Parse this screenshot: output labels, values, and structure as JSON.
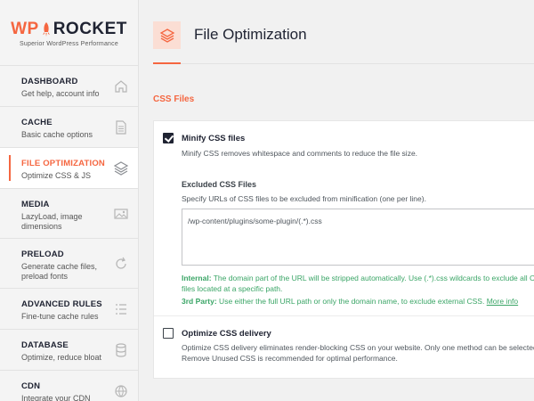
{
  "brand": {
    "wp": "WP",
    "rocket": "ROCKET",
    "tagline": "Superior WordPress Performance",
    "accent_color": "#f56640"
  },
  "nav": {
    "items": [
      {
        "title": "DASHBOARD",
        "subtitle": "Get help, account info",
        "icon": "home-icon"
      },
      {
        "title": "CACHE",
        "subtitle": "Basic cache options",
        "icon": "document-icon"
      },
      {
        "title": "FILE OPTIMIZATION",
        "subtitle": "Optimize CSS & JS",
        "icon": "layers-icon",
        "active": true
      },
      {
        "title": "MEDIA",
        "subtitle": "LazyLoad, image dimensions",
        "icon": "image-icon"
      },
      {
        "title": "PRELOAD",
        "subtitle": "Generate cache files, preload fonts",
        "icon": "refresh-icon"
      },
      {
        "title": "ADVANCED RULES",
        "subtitle": "Fine-tune cache rules",
        "icon": "list-icon"
      },
      {
        "title": "DATABASE",
        "subtitle": "Optimize, reduce bloat",
        "icon": "database-icon"
      },
      {
        "title": "CDN",
        "subtitle": "Integrate your CDN",
        "icon": "cdn-icon"
      }
    ]
  },
  "header": {
    "title": "File Optimization",
    "icon": "layers-icon"
  },
  "section": {
    "title": "CSS Files"
  },
  "minify": {
    "label": "Minify CSS files",
    "checked": true,
    "description": "Minify CSS removes whitespace and comments to reduce the file size."
  },
  "excluded": {
    "label": "Excluded CSS Files",
    "description": "Specify URLs of CSS files to be excluded from minification (one per line).",
    "value": "/wp-content/plugins/some-plugin/(.*).css",
    "help_internal_label": "Internal:",
    "help_internal_text": " The domain part of the URL will be stripped automatically. Use (.*).css wildcards to exclude all CSS files located at a specific path.",
    "help_third_label": "3rd Party:",
    "help_third_text": " Use either the full URL path or only the domain name, to exclude external CSS. ",
    "more_info": "More info"
  },
  "delivery": {
    "label": "Optimize CSS delivery",
    "checked": false,
    "description": "Optimize CSS delivery eliminates render-blocking CSS on your website. Only one method can be selected. Remove Unused CSS is recommended for optimal performance."
  }
}
